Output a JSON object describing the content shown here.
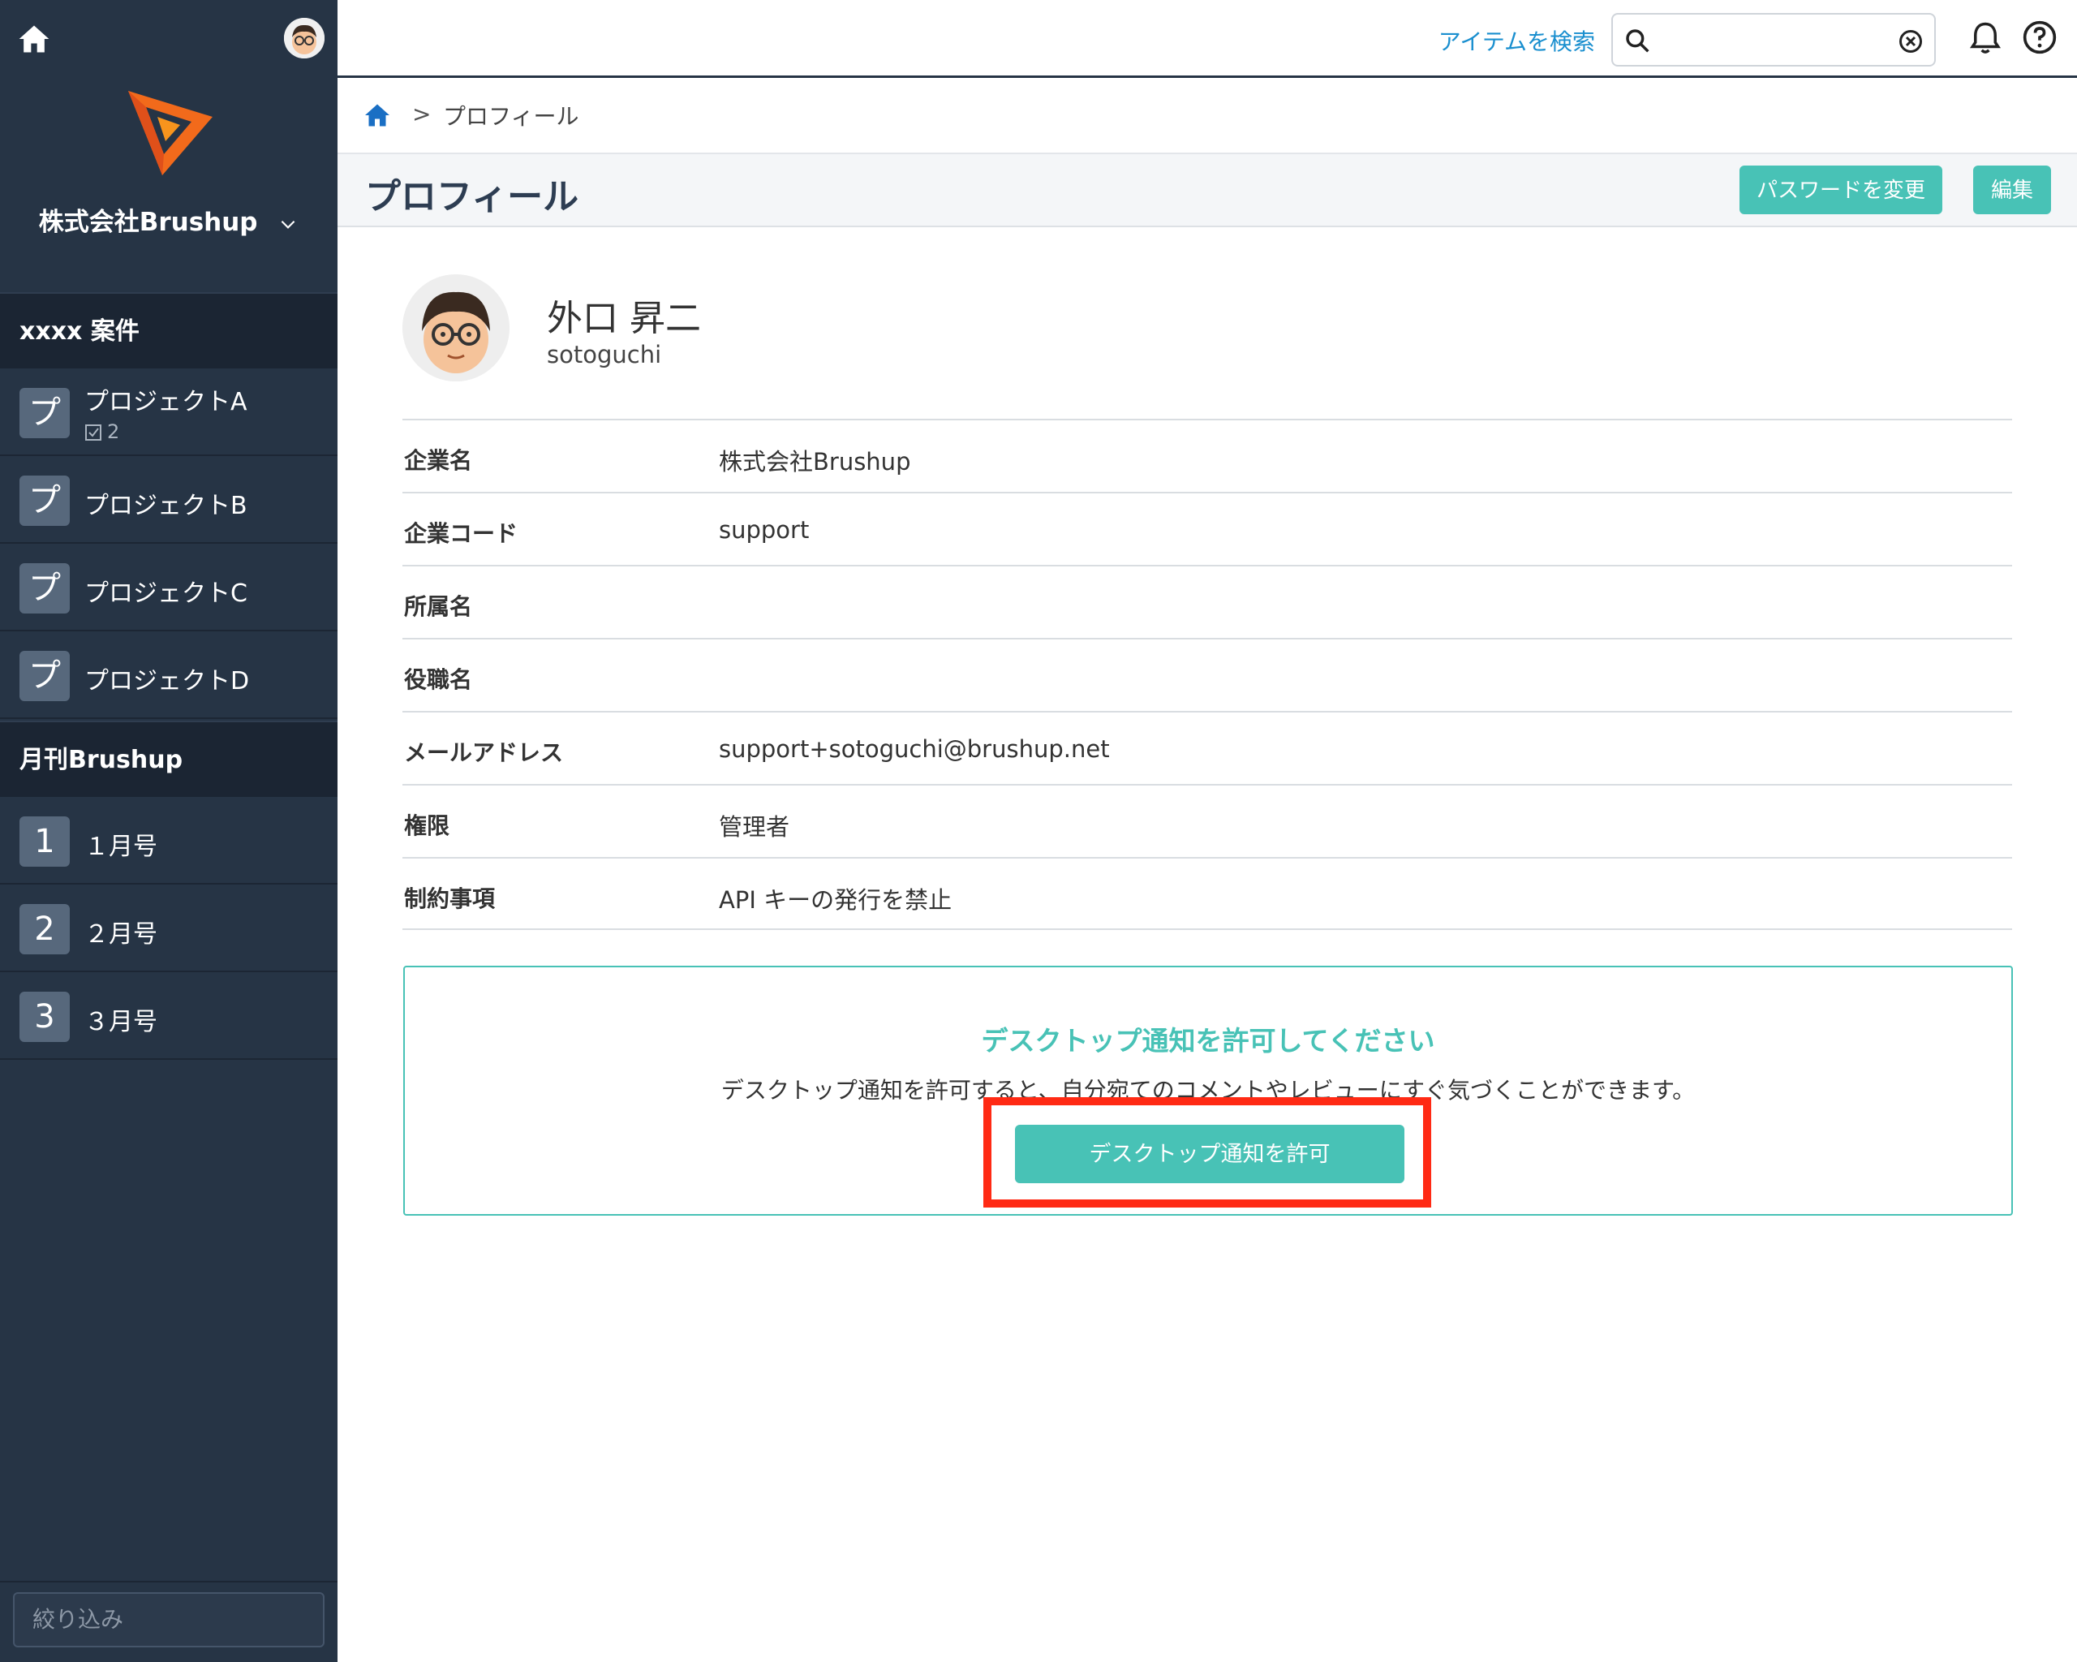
{
  "sidebar": {
    "company": "株式会社Brushup",
    "groups": [
      {
        "title": "xxxx 案件",
        "items": [
          {
            "badge": "プ",
            "label": "プロジェクトA",
            "sub_count": "2"
          },
          {
            "badge": "プ",
            "label": "プロジェクトB"
          },
          {
            "badge": "プ",
            "label": "プロジェクトC"
          },
          {
            "badge": "プ",
            "label": "プロジェクトD"
          }
        ]
      },
      {
        "title": "月刊Brushup",
        "items": [
          {
            "badge": "1",
            "label": "１月号"
          },
          {
            "badge": "2",
            "label": "２月号"
          },
          {
            "badge": "3",
            "label": "３月号"
          }
        ]
      }
    ],
    "filter_placeholder": "絞り込み"
  },
  "topbar": {
    "search_link": "アイテムを検索",
    "search_value": ""
  },
  "breadcrumb": {
    "separator": ">",
    "current": "プロフィール"
  },
  "page": {
    "title": "プロフィール",
    "change_password": "パスワードを変更",
    "edit": "編集"
  },
  "profile": {
    "name": "外口 昇二",
    "username": "sotoguchi",
    "fields": [
      {
        "label": "企業名",
        "value": "株式会社Brushup"
      },
      {
        "label": "企業コード",
        "value": "support"
      },
      {
        "label": "所属名",
        "value": ""
      },
      {
        "label": "役職名",
        "value": ""
      },
      {
        "label": "メールアドレス",
        "value": "support+sotoguchi@brushup.net"
      },
      {
        "label": "権限",
        "value": "管理者"
      },
      {
        "label": "制約事項",
        "value": "API キーの発行を禁止"
      }
    ]
  },
  "notify": {
    "title": "デスクトップ通知を許可してください",
    "description": "デスクトップ通知を許可すると、自分宛てのコメントやレビューにすぐ気づくことができます。",
    "button": "デスクトップ通知を許可"
  },
  "colors": {
    "sidebar_bg": "#263445",
    "accent": "#48c2b6",
    "link": "#1a8fcf",
    "highlight": "#ff2a14"
  }
}
